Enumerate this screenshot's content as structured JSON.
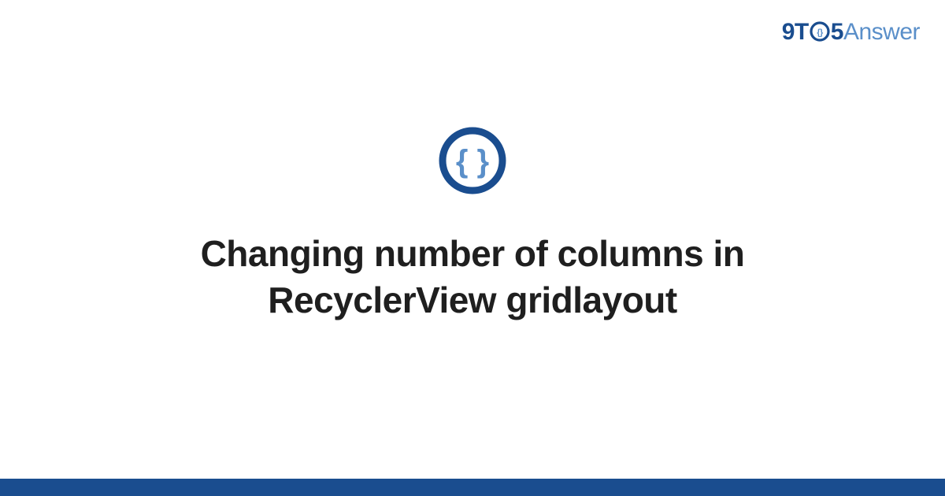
{
  "logo": {
    "part1": "9T",
    "part2": "5",
    "part3": "Answer"
  },
  "icon": {
    "name": "code-braces-icon",
    "ring_color": "#1a4d8f",
    "brace_color": "#5a8fc9"
  },
  "title": "Changing number of columns in RecyclerView gridlayout",
  "colors": {
    "brand_dark": "#1a4d8f",
    "brand_light": "#5a8fc9",
    "text": "#1f1f1f",
    "background": "#ffffff"
  }
}
